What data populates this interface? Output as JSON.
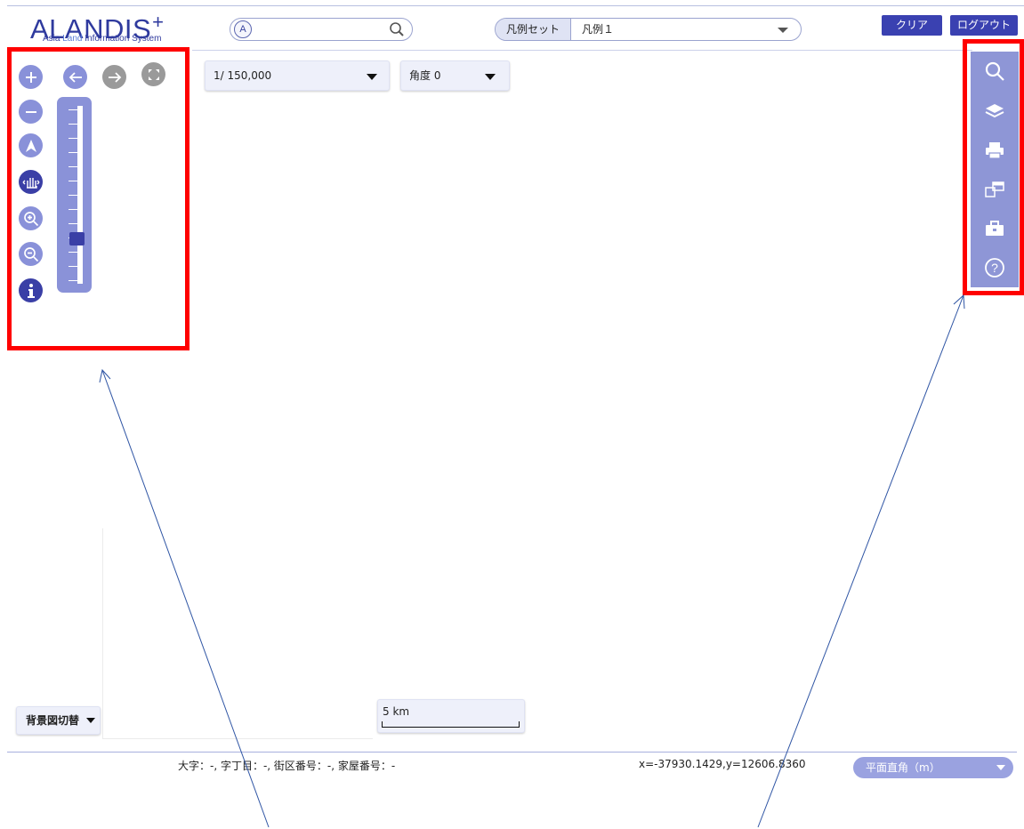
{
  "header": {
    "logo_main": "ALANDIS",
    "logo_plus": "+",
    "logo_sub_a": "Asia ",
    "logo_sub_b": "Land",
    "logo_sub_c": " Information System",
    "search": {
      "badge": "A",
      "placeholder": ""
    },
    "legend_set_label": "凡例セット",
    "legend_set_value": "凡例１",
    "clear_label": "クリア",
    "logout_label": "ログアウト"
  },
  "left_tools": {
    "icons": [
      "zoom-in-icon",
      "zoom-out-icon",
      "back-icon",
      "forward-icon",
      "full-extent-icon",
      "north-arrow-icon",
      "pan-hand-icon",
      "zoom-in-tool-icon",
      "zoom-out-tool-icon",
      "info-icon"
    ],
    "zoom_level_fraction": 0.22
  },
  "map_controls": {
    "scale_value": "1/ 150,000",
    "angle_value": "角度 0"
  },
  "right_tools": {
    "icons": [
      "search-icon",
      "layers-icon",
      "print-icon",
      "windows-icon",
      "toolbox-icon",
      "help-icon"
    ]
  },
  "bottom": {
    "background_switch_label": "背景図切替",
    "scale_bar_label": "5 km",
    "address_text": "大字：-, 字丁目：-, 街区番号：-, 家屋番号：-",
    "coordinate_text": "x=-37930.1429,y=12606.8360",
    "crs_value": "平面直角（m）"
  },
  "colors": {
    "brand": "#2f3a9e",
    "button_dark": "#3a41b1",
    "tool_light": "#8991d9",
    "highlight": "#ff0000"
  }
}
